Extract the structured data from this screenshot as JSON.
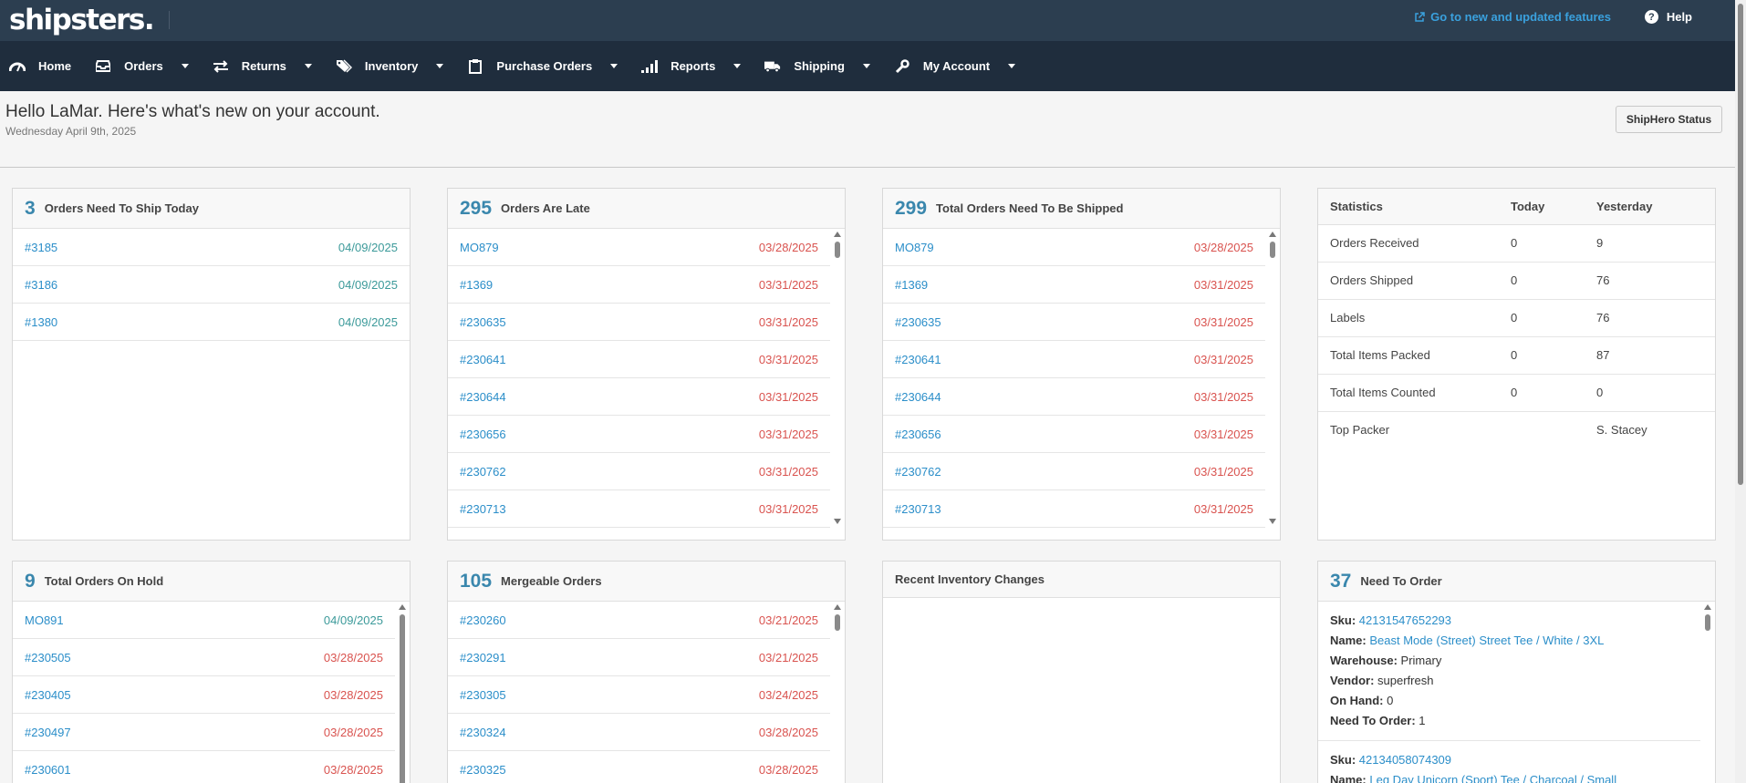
{
  "topbar": {
    "logo_text": "shipsters.",
    "new_features": "Go to new and updated features",
    "help": "Help"
  },
  "nav": [
    {
      "label": "Home",
      "icon": "dashboard-icon",
      "dropdown": false
    },
    {
      "label": "Orders",
      "icon": "inbox-icon",
      "dropdown": true
    },
    {
      "label": "Returns",
      "icon": "exchange-icon",
      "dropdown": true
    },
    {
      "label": "Inventory",
      "icon": "tags-icon",
      "dropdown": true
    },
    {
      "label": "Purchase Orders",
      "icon": "clipboard-icon",
      "dropdown": true
    },
    {
      "label": "Reports",
      "icon": "signal-icon",
      "dropdown": true
    },
    {
      "label": "Shipping",
      "icon": "truck-icon",
      "dropdown": true
    },
    {
      "label": "My Account",
      "icon": "wrench-icon",
      "dropdown": true
    }
  ],
  "greeting": {
    "text": "Hello LaMar. Here's what's new on your account.",
    "date": "Wednesday April 9th, 2025",
    "status_button": "ShipHero Status"
  },
  "ship_today": {
    "count": "3",
    "title": "Orders Need To Ship Today",
    "rows": [
      {
        "id": "#3185",
        "date": "04/09/2025",
        "late": false
      },
      {
        "id": "#3186",
        "date": "04/09/2025",
        "late": false
      },
      {
        "id": "#1380",
        "date": "04/09/2025",
        "late": false
      }
    ]
  },
  "late": {
    "count": "295",
    "title": "Orders Are Late",
    "rows": [
      {
        "id": "MO879",
        "date": "03/28/2025",
        "late": true
      },
      {
        "id": "#1369",
        "date": "03/31/2025",
        "late": true
      },
      {
        "id": "#230635",
        "date": "03/31/2025",
        "late": true
      },
      {
        "id": "#230641",
        "date": "03/31/2025",
        "late": true
      },
      {
        "id": "#230644",
        "date": "03/31/2025",
        "late": true
      },
      {
        "id": "#230656",
        "date": "03/31/2025",
        "late": true
      },
      {
        "id": "#230762",
        "date": "03/31/2025",
        "late": true
      },
      {
        "id": "#230713",
        "date": "03/31/2025",
        "late": true
      }
    ]
  },
  "total_to_ship": {
    "count": "299",
    "title": "Total Orders Need To Be Shipped",
    "rows": [
      {
        "id": "MO879",
        "date": "03/28/2025",
        "late": true
      },
      {
        "id": "#1369",
        "date": "03/31/2025",
        "late": true
      },
      {
        "id": "#230635",
        "date": "03/31/2025",
        "late": true
      },
      {
        "id": "#230641",
        "date": "03/31/2025",
        "late": true
      },
      {
        "id": "#230644",
        "date": "03/31/2025",
        "late": true
      },
      {
        "id": "#230656",
        "date": "03/31/2025",
        "late": true
      },
      {
        "id": "#230762",
        "date": "03/31/2025",
        "late": true
      },
      {
        "id": "#230713",
        "date": "03/31/2025",
        "late": true
      }
    ]
  },
  "statistics": {
    "headers": [
      "Statistics",
      "Today",
      "Yesterday"
    ],
    "rows": [
      [
        "Orders Received",
        "0",
        "9"
      ],
      [
        "Orders Shipped",
        "0",
        "76"
      ],
      [
        "Labels",
        "0",
        "76"
      ],
      [
        "Total Items Packed",
        "0",
        "87"
      ],
      [
        "Total Items Counted",
        "0",
        "0"
      ],
      [
        "Top Packer",
        "",
        "S. Stacey"
      ]
    ]
  },
  "on_hold": {
    "count": "9",
    "title": "Total Orders On Hold",
    "rows": [
      {
        "id": "MO891",
        "date": "04/09/2025",
        "late": false
      },
      {
        "id": "#230505",
        "date": "03/28/2025",
        "late": true
      },
      {
        "id": "#230405",
        "date": "03/28/2025",
        "late": true
      },
      {
        "id": "#230497",
        "date": "03/28/2025",
        "late": true
      },
      {
        "id": "#230601",
        "date": "03/28/2025",
        "late": true
      }
    ]
  },
  "mergeable": {
    "count": "105",
    "title": "Mergeable Orders",
    "rows": [
      {
        "id": "#230260",
        "date": "03/21/2025",
        "late": true
      },
      {
        "id": "#230291",
        "date": "03/21/2025",
        "late": true
      },
      {
        "id": "#230305",
        "date": "03/24/2025",
        "late": true
      },
      {
        "id": "#230324",
        "date": "03/28/2025",
        "late": true
      },
      {
        "id": "#230325",
        "date": "03/28/2025",
        "late": true
      }
    ]
  },
  "inventory_changes": {
    "title": "Recent Inventory Changes"
  },
  "need_to_order": {
    "count": "37",
    "title": "Need To Order",
    "labels": {
      "sku": "Sku:",
      "name": "Name:",
      "warehouse": "Warehouse:",
      "vendor": "Vendor:",
      "on_hand": "On Hand:",
      "need": "Need To Order:"
    },
    "items": [
      {
        "sku": "42131547652293",
        "name": "Beast Mode (Street) Street Tee / White / 3XL",
        "warehouse": "Primary",
        "vendor": "superfresh",
        "on_hand": "0",
        "need": "1"
      },
      {
        "sku": "42134058074309",
        "name": "Leg Day Unicorn (Sport) Tee / Charcoal / Small",
        "warehouse": "",
        "vendor": "",
        "on_hand": "",
        "need": ""
      }
    ]
  },
  "colors": {
    "topbar": "#2c3e50",
    "navbar": "#1f2d3d",
    "link": "#2b8ec9",
    "late": "#d9534f",
    "on_time": "#3c9a9a",
    "count": "#3a87ad"
  }
}
